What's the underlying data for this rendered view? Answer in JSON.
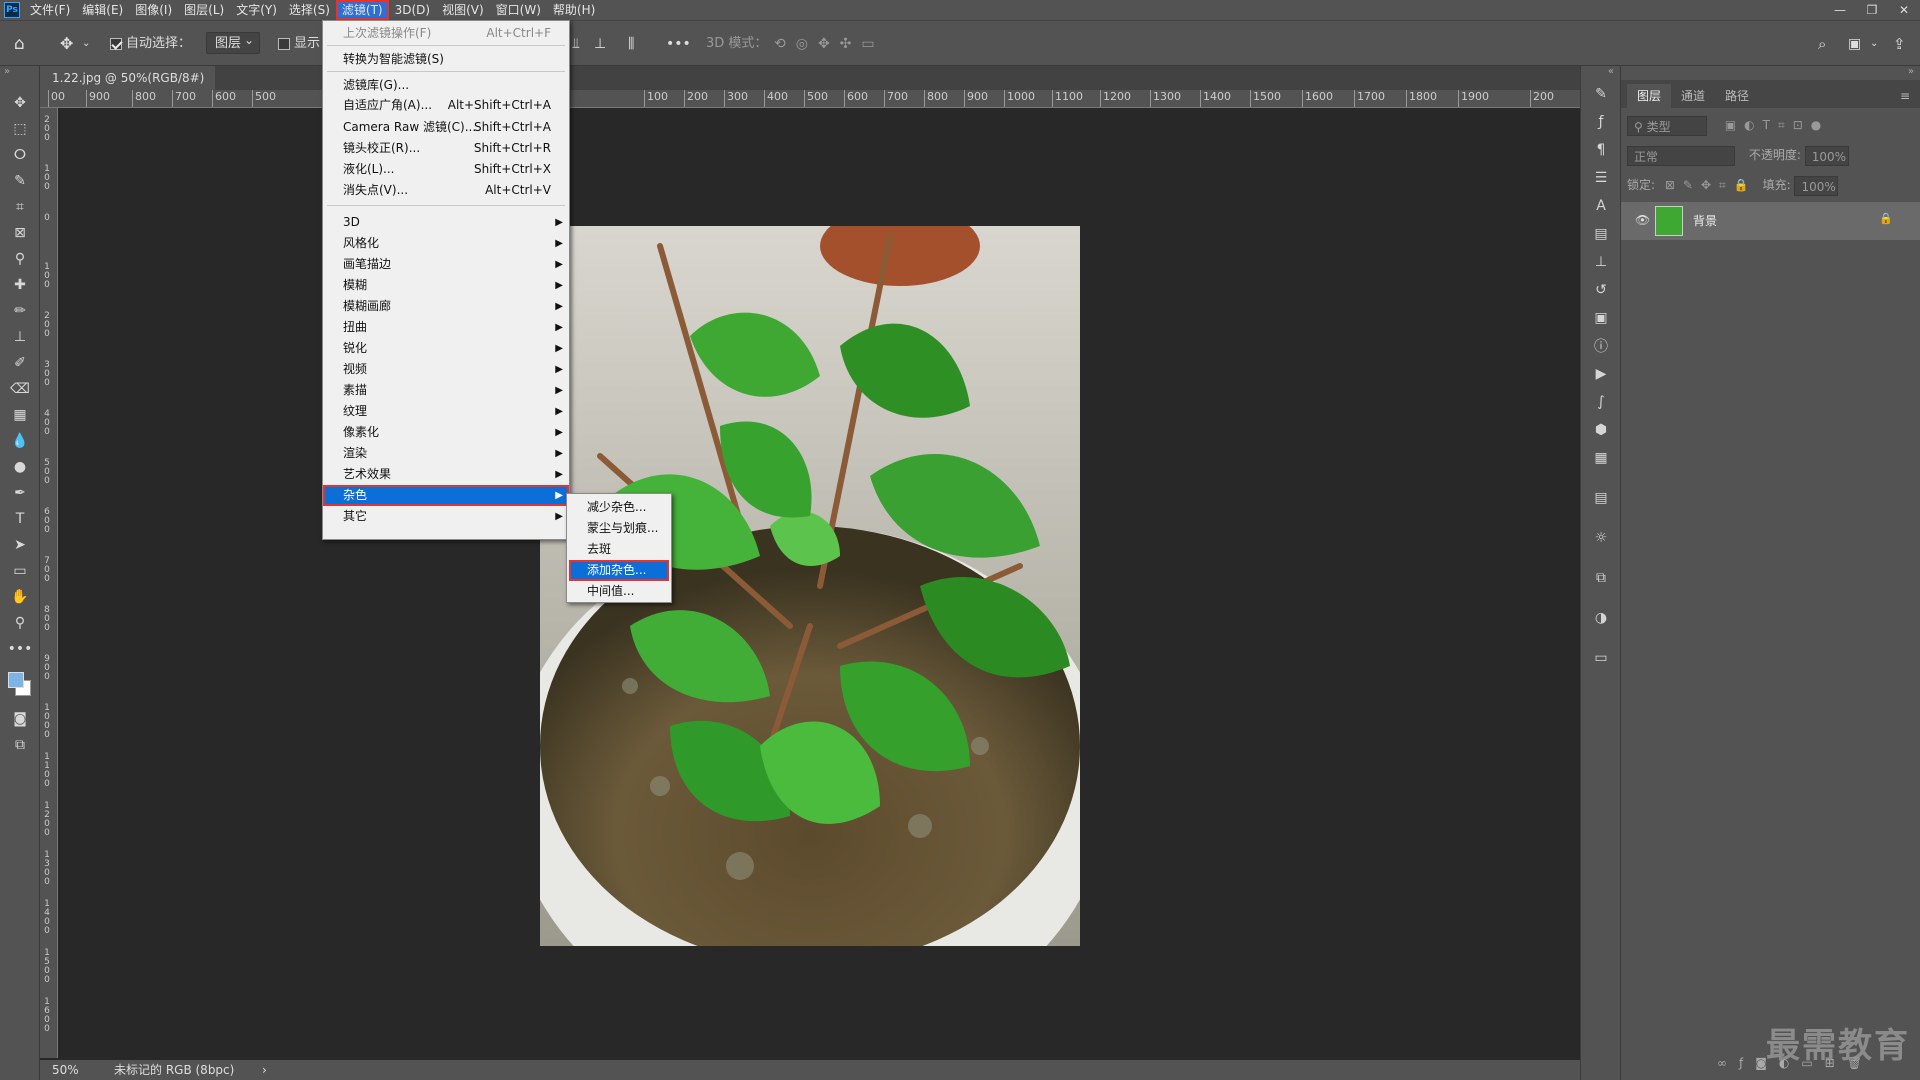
{
  "menubar": {
    "logo": "Ps",
    "items": [
      "文件(F)",
      "编辑(E)",
      "图像(I)",
      "图层(L)",
      "文字(Y)",
      "选择(S)",
      "滤镜(T)",
      "3D(D)",
      "视图(V)",
      "窗口(W)",
      "帮助(H)"
    ],
    "active_index": 6,
    "window_controls": [
      "—",
      "❐",
      "✕"
    ]
  },
  "options": {
    "auto_select_label": "自动选择：",
    "auto_select_checked": true,
    "layer_select": "图层",
    "show_label": "显示",
    "mode3d_label": "3D 模式："
  },
  "doc_tab": {
    "title": "1.22.jpg @ 50%(RGB/8#)",
    "close": "×"
  },
  "ruler": {
    "h_ticks": [
      "00",
      "900",
      "800",
      "700",
      "600",
      "500",
      "100",
      "200",
      "300",
      "400",
      "500",
      "600",
      "700",
      "800",
      "900",
      "1000",
      "1100",
      "1200",
      "1300",
      "1400",
      "1500",
      "1600",
      "1700",
      "1800",
      "1900",
      "200"
    ],
    "v_ticks": [
      "2\n0\n0",
      "1\n0\n0",
      "0",
      "1\n0\n0",
      "2\n0\n0",
      "3\n0\n0",
      "4\n0\n0",
      "5\n0\n0",
      "6\n0\n0",
      "7\n0\n0",
      "8\n0\n0",
      "9\n0\n0",
      "1\n0\n0\n0",
      "1\n1\n0\n0",
      "1\n2\n0\n0",
      "1\n3\n0\n0",
      "1\n4\n0\n0",
      "1\n5\n0\n0",
      "1\n6\n0\n0"
    ]
  },
  "filter_menu": {
    "items": [
      {
        "label": "上次滤镜操作(F)",
        "shortcut": "Alt+Ctrl+F",
        "disabled": true
      },
      {
        "label": "转换为智能滤镜(S)",
        "shortcut": ""
      },
      {
        "label": "滤镜库(G)...",
        "shortcut": ""
      },
      {
        "label": "自适应广角(A)...",
        "shortcut": "Alt+Shift+Ctrl+A"
      },
      {
        "label": "Camera Raw 滤镜(C)...",
        "shortcut": "Shift+Ctrl+A"
      },
      {
        "label": "镜头校正(R)...",
        "shortcut": "Shift+Ctrl+R"
      },
      {
        "label": "液化(L)...",
        "shortcut": "Shift+Ctrl+X"
      },
      {
        "label": "消失点(V)...",
        "shortcut": "Alt+Ctrl+V"
      },
      {
        "label": "3D",
        "submenu": true
      },
      {
        "label": "风格化",
        "submenu": true
      },
      {
        "label": "画笔描边",
        "submenu": true
      },
      {
        "label": "模糊",
        "submenu": true
      },
      {
        "label": "模糊画廊",
        "submenu": true
      },
      {
        "label": "扭曲",
        "submenu": true
      },
      {
        "label": "锐化",
        "submenu": true
      },
      {
        "label": "视频",
        "submenu": true
      },
      {
        "label": "素描",
        "submenu": true
      },
      {
        "label": "纹理",
        "submenu": true
      },
      {
        "label": "像素化",
        "submenu": true
      },
      {
        "label": "渲染",
        "submenu": true
      },
      {
        "label": "艺术效果",
        "submenu": true
      },
      {
        "label": "杂色",
        "submenu": true,
        "highlighted": true
      },
      {
        "label": "其它",
        "submenu": true
      }
    ]
  },
  "noise_submenu": {
    "items": [
      "减少杂色...",
      "蒙尘与划痕...",
      "去斑",
      "添加杂色...",
      "中间值..."
    ],
    "highlighted_index": 3
  },
  "status": {
    "zoom": "50%",
    "profile": "未标记的 RGB (8bpc)",
    "arrow": "›"
  },
  "layers_panel": {
    "tabs": [
      "图层",
      "通道",
      "路径"
    ],
    "filter_placeholder": "类型",
    "blend_mode": "正常",
    "opacity_label": "不透明度:",
    "opacity_value": "100%",
    "lock_label": "锁定:",
    "fill_label": "填充:",
    "fill_value": "100%",
    "layer_name": "背景"
  },
  "watermark": "最需教育",
  "colors": {
    "accent": "#0a6fd6",
    "highlight_border": "#e53333",
    "panel": "#535353",
    "canvas": "#282828"
  }
}
